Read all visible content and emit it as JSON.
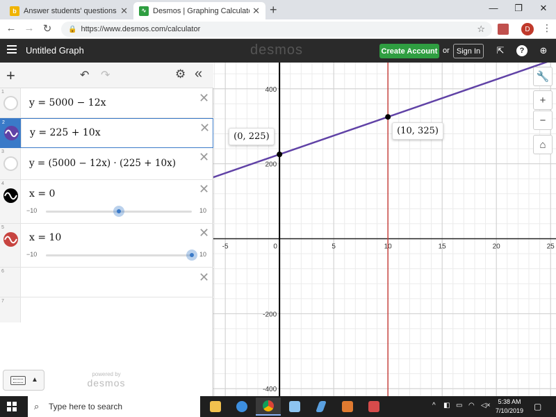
{
  "browser": {
    "tabs": [
      {
        "label": "Answer students' questions and he",
        "favicon": "brainly-icon",
        "active": false
      },
      {
        "label": "Desmos | Graphing Calculator",
        "favicon": "desmos-icon",
        "active": true
      }
    ],
    "url": "https://www.desmos.com/calculator",
    "avatar_letter": "D"
  },
  "header": {
    "title": "Untitled Graph",
    "logo": "desmos",
    "create_account": "Create Account",
    "or": "or",
    "sign_in": "Sign In"
  },
  "expressions": [
    {
      "num": "1",
      "latex": "y = 5000 − 12x",
      "color": ""
    },
    {
      "num": "2",
      "latex": "y = 225 + 10x",
      "color": "#6042a6"
    },
    {
      "num": "3",
      "latex": "y = (5000 − 12x) · (225 + 10x)",
      "color": ""
    },
    {
      "num": "4",
      "latex": "x = 0",
      "color": "#000000",
      "slider": {
        "min": "−10",
        "max": "10",
        "value": 0
      }
    },
    {
      "num": "5",
      "latex": "x = 10",
      "color": "#c74440",
      "slider": {
        "min": "−10",
        "max": "10",
        "value": 10
      }
    },
    {
      "num": "6",
      "latex": ""
    },
    {
      "num": "7",
      "latex": ""
    }
  ],
  "powered_by": {
    "line1": "powered by",
    "line2": "desmos"
  },
  "chart_data": {
    "type": "line",
    "xlim": [
      -6.1,
      25.5
    ],
    "ylim": [
      -420,
      470
    ],
    "x_ticks": [
      -5,
      0,
      5,
      10,
      15,
      20,
      25
    ],
    "x_tick_labels": [
      "-5",
      "0",
      "5",
      "10",
      "15",
      "20",
      "25"
    ],
    "y_ticks": [
      -400,
      -200,
      200,
      400
    ],
    "y_tick_labels": [
      "-400",
      "-200",
      "200",
      "400"
    ],
    "grid": true,
    "series": [
      {
        "kind": "line",
        "slope": 10,
        "intercept": 225,
        "color": "#6042a6"
      },
      {
        "kind": "vertical",
        "x": 0,
        "color": "#000000"
      },
      {
        "kind": "vertical",
        "x": 10,
        "color": "#c74440"
      }
    ],
    "points": [
      {
        "x": 0,
        "y": 225,
        "label": "(0, 225)"
      },
      {
        "x": 10,
        "y": 325,
        "label": "(10, 325)"
      }
    ]
  },
  "taskbar": {
    "search_placeholder": "Type here to search",
    "time": "5:38 AM",
    "date": "7/10/2019"
  }
}
